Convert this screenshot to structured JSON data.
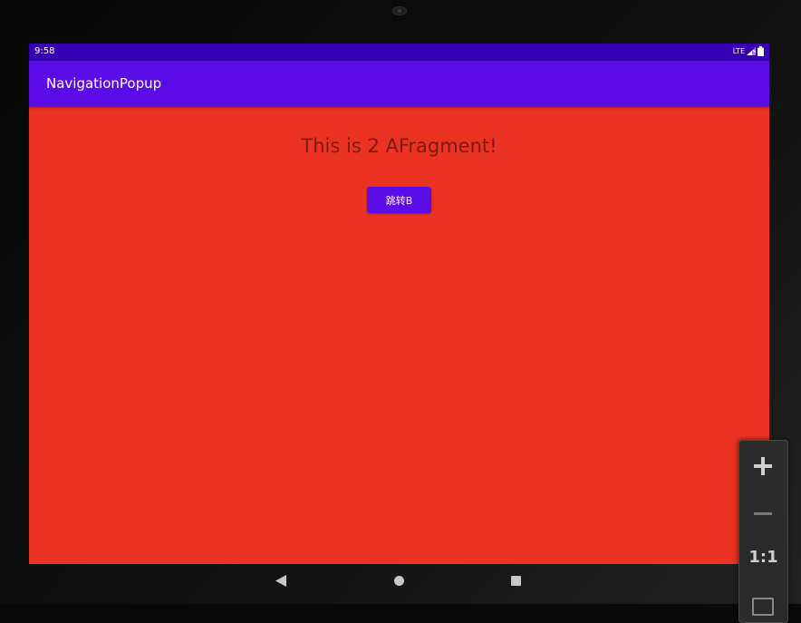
{
  "status_bar": {
    "time": "9:58",
    "network": "LTE"
  },
  "app_bar": {
    "title": "NavigationPopup"
  },
  "content": {
    "fragment_text": "This is 2 AFragment!",
    "jump_button_label": "跳转B"
  },
  "zoom_controls": {
    "reset_label": "1:1"
  },
  "colors": {
    "status_bar": "#3700b3",
    "app_bar": "#5a0be6",
    "background": "#ea3323",
    "fragment_text": "#7a1a14",
    "button": "#5a0be6"
  },
  "icons": {
    "signal": "signal-icon",
    "battery": "battery-icon",
    "back": "back-icon",
    "home": "home-icon",
    "recents": "recents-icon",
    "zoom_in": "plus-icon",
    "zoom_out": "minus-icon",
    "zoom_fit": "fit-screen-icon"
  }
}
